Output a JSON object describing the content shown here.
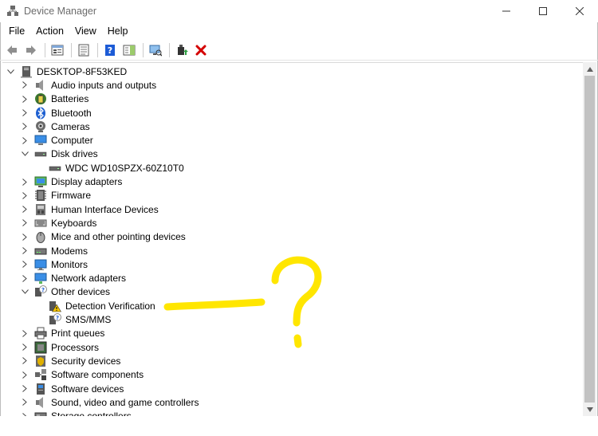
{
  "window": {
    "title": "Device Manager",
    "minimize_glyph": "—",
    "maximize_glyph": "☐",
    "close_glyph": "✕"
  },
  "menu": [
    "File",
    "Action",
    "View",
    "Help"
  ],
  "toolbar": {
    "buttons": [
      "back-arrow-icon",
      "forward-arrow-icon",
      "properties-icon",
      "tree-view-icon",
      "help-icon",
      "action-pane-icon",
      "scan-hardware-icon",
      "update-driver-icon",
      "uninstall-icon"
    ]
  },
  "tree": {
    "root": "DESKTOP-8F53KED",
    "items": [
      {
        "label": "Audio inputs and outputs",
        "icon": "speaker-icon",
        "level": 1,
        "expanded": false
      },
      {
        "label": "Batteries",
        "icon": "battery-icon",
        "level": 1,
        "expanded": false
      },
      {
        "label": "Bluetooth",
        "icon": "bluetooth-icon",
        "level": 1,
        "expanded": false
      },
      {
        "label": "Cameras",
        "icon": "camera-icon",
        "level": 1,
        "expanded": false
      },
      {
        "label": "Computer",
        "icon": "computer-icon",
        "level": 1,
        "expanded": false
      },
      {
        "label": "Disk drives",
        "icon": "disk-icon",
        "level": 1,
        "expanded": true
      },
      {
        "label": "WDC WD10SPZX-60Z10T0",
        "icon": "disk-icon",
        "level": 2
      },
      {
        "label": "Display adapters",
        "icon": "display-adapter-icon",
        "level": 1,
        "expanded": false
      },
      {
        "label": "Firmware",
        "icon": "firmware-icon",
        "level": 1,
        "expanded": false
      },
      {
        "label": "Human Interface Devices",
        "icon": "hid-icon",
        "level": 1,
        "expanded": false
      },
      {
        "label": "Keyboards",
        "icon": "keyboard-icon",
        "level": 1,
        "expanded": false
      },
      {
        "label": "Mice and other pointing devices",
        "icon": "mouse-icon",
        "level": 1,
        "expanded": false
      },
      {
        "label": "Modems",
        "icon": "modem-icon",
        "level": 1,
        "expanded": false
      },
      {
        "label": "Monitors",
        "icon": "monitor-icon",
        "level": 1,
        "expanded": false
      },
      {
        "label": "Network adapters",
        "icon": "network-icon",
        "level": 1,
        "expanded": false
      },
      {
        "label": "Other devices",
        "icon": "unknown-device-icon",
        "level": 1,
        "expanded": true
      },
      {
        "label": "Detection Verification",
        "icon": "warning-device-icon",
        "level": 2
      },
      {
        "label": "SMS/MMS",
        "icon": "unknown-device-icon",
        "level": 2
      },
      {
        "label": "Print queues",
        "icon": "printer-icon",
        "level": 1,
        "expanded": false
      },
      {
        "label": "Processors",
        "icon": "processor-icon",
        "level": 1,
        "expanded": false
      },
      {
        "label": "Security devices",
        "icon": "security-icon",
        "level": 1,
        "expanded": false
      },
      {
        "label": "Software components",
        "icon": "software-component-icon",
        "level": 1,
        "expanded": false
      },
      {
        "label": "Software devices",
        "icon": "software-device-icon",
        "level": 1,
        "expanded": false
      },
      {
        "label": "Sound, video and game controllers",
        "icon": "speaker-icon",
        "level": 1,
        "expanded": false
      },
      {
        "label": "Storage controllers",
        "icon": "storage-icon",
        "level": 1,
        "expanded": false
      }
    ]
  },
  "colors": {
    "annotation": "#ffe600",
    "title_text": "#6b6b6b",
    "uninstall_red": "#d40000",
    "help_blue": "#1c5bd6"
  }
}
